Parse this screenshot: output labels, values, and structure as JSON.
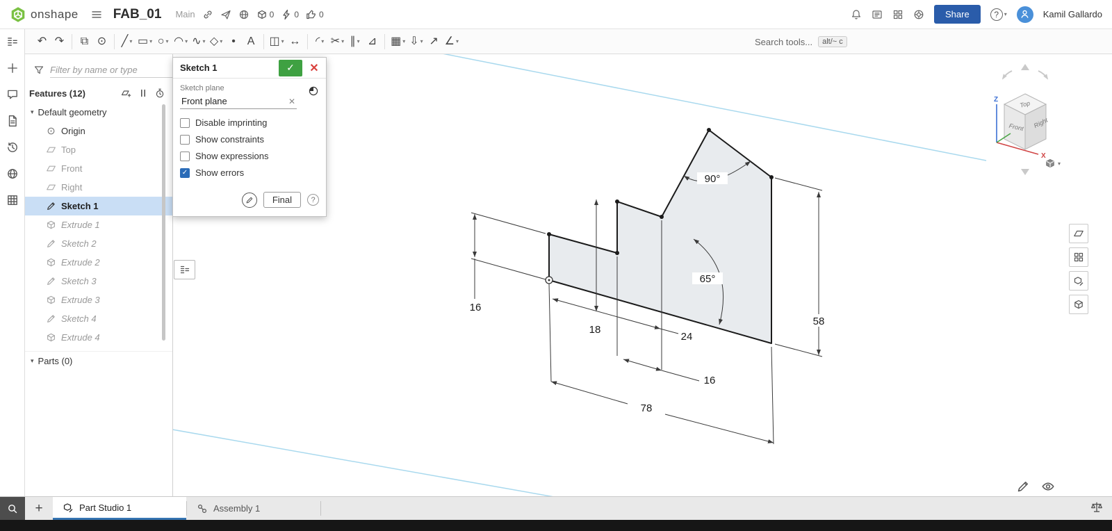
{
  "topbar": {
    "logo_text": "onshape",
    "doc_title": "FAB_01",
    "branch_label": "Main",
    "export_count": "0",
    "history_count": "0",
    "likes_count": "0",
    "share_label": "Share",
    "help_label": "?",
    "user_name": "Kamil Gallardo"
  },
  "toolbar": {
    "search_text": "Search tools...",
    "search_shortcut": "alt/~ c",
    "tools": [
      {
        "id": "undo",
        "glyph": "↶",
        "caret": false
      },
      {
        "id": "redo",
        "glyph": "↷",
        "caret": false
      },
      {
        "id": "copy",
        "glyph": "⧉",
        "caret": false
      },
      {
        "id": "sketch-region",
        "glyph": "⊙",
        "caret": false
      },
      {
        "id": "line",
        "glyph": "╱",
        "caret": true
      },
      {
        "id": "rectangle",
        "glyph": "▭",
        "caret": true
      },
      {
        "id": "circle",
        "glyph": "○",
        "caret": true
      },
      {
        "id": "arc",
        "glyph": "◠",
        "caret": true
      },
      {
        "id": "spline",
        "glyph": "∿",
        "caret": true
      },
      {
        "id": "polygon",
        "glyph": "◇",
        "caret": true
      },
      {
        "id": "point",
        "glyph": "•",
        "caret": false
      },
      {
        "id": "text",
        "glyph": "A",
        "caret": false
      },
      {
        "id": "mirror",
        "glyph": "◫",
        "caret": true
      },
      {
        "id": "dimension",
        "glyph": "↔",
        "caret": false
      },
      {
        "id": "fillet",
        "glyph": "◜",
        "caret": true
      },
      {
        "id": "trim",
        "glyph": "✂",
        "caret": true
      },
      {
        "id": "offset",
        "glyph": "∥",
        "caret": true
      },
      {
        "id": "measure",
        "glyph": "⊿",
        "caret": false
      },
      {
        "id": "pattern",
        "glyph": "▦",
        "caret": true
      },
      {
        "id": "import-dxf",
        "glyph": "⇩",
        "caret": true
      },
      {
        "id": "transform",
        "glyph": "↗",
        "caret": false
      },
      {
        "id": "constraint",
        "glyph": "∠",
        "caret": true
      }
    ]
  },
  "left_rail": {
    "items": [
      {
        "id": "feature-list",
        "icon": "list"
      },
      {
        "id": "insert",
        "icon": "plus"
      },
      {
        "id": "comments",
        "icon": "comment"
      },
      {
        "id": "notes",
        "icon": "doc"
      },
      {
        "id": "history",
        "icon": "history"
      },
      {
        "id": "publications",
        "icon": "globe"
      },
      {
        "id": "tables",
        "icon": "grid"
      }
    ]
  },
  "feature_panel": {
    "filter_placeholder": "Filter by name or type",
    "features_header": "Features (12)",
    "parts_header": "Parts (0)",
    "tree": [
      {
        "label": "Default geometry",
        "type": "group",
        "state": "none"
      },
      {
        "label": "Origin",
        "type": "origin",
        "state": "none"
      },
      {
        "label": "Top",
        "type": "plane",
        "state": "dim"
      },
      {
        "label": "Front",
        "type": "plane",
        "state": "dim"
      },
      {
        "label": "Right",
        "type": "plane",
        "state": "dim"
      },
      {
        "label": "Sketch 1",
        "type": "sketch",
        "state": "selected"
      },
      {
        "label": "Extrude 1",
        "type": "extrude",
        "state": "after"
      },
      {
        "label": "Sketch 2",
        "type": "sketch",
        "state": "after"
      },
      {
        "label": "Extrude 2",
        "type": "extrude",
        "state": "after"
      },
      {
        "label": "Sketch 3",
        "type": "sketch",
        "state": "after"
      },
      {
        "label": "Extrude 3",
        "type": "extrude",
        "state": "after"
      },
      {
        "label": "Sketch 4",
        "type": "sketch",
        "state": "after"
      },
      {
        "label": "Extrude 4",
        "type": "extrude",
        "state": "after"
      }
    ]
  },
  "dialog": {
    "title": "Sketch 1",
    "plane_label": "Sketch plane",
    "plane_value": "Front plane",
    "checkboxes": [
      {
        "label": "Disable imprinting",
        "checked": false
      },
      {
        "label": "Show constraints",
        "checked": false
      },
      {
        "label": "Show expressions",
        "checked": false
      },
      {
        "label": "Show errors",
        "checked": true
      }
    ],
    "final_label": "Final"
  },
  "canvas": {
    "dims": {
      "angle_top": "90°",
      "angle_mid": "65°",
      "left_height": "16",
      "step_height": "18",
      "mid_width": "24",
      "notch_width": "16",
      "right_height": "58",
      "base_width": "78"
    }
  },
  "viewcube": {
    "top": "Top",
    "front": "Front",
    "right": "Right",
    "axis_z": "Z",
    "axis_x": "X"
  },
  "right_dock": {
    "items": [
      {
        "id": "display-panel",
        "icon": "plane"
      },
      {
        "id": "appearance-panel",
        "icon": "apps"
      },
      {
        "id": "configuration-panel",
        "icon": "parttab"
      },
      {
        "id": "custom-table-panel",
        "icon": "box"
      }
    ]
  },
  "canvas_icons": [
    {
      "id": "sketch-settings",
      "icon": "pencil"
    },
    {
      "id": "view-settings",
      "icon": "eye"
    }
  ],
  "tabs": {
    "items": [
      {
        "label": "Part Studio 1",
        "active": true
      },
      {
        "label": "Assembly 1",
        "active": false
      }
    ]
  },
  "colors": {
    "accent_blue": "#2a5caa",
    "logo_green": "#7ac143",
    "commit_green": "#3fa142",
    "cancel_red": "#d9413d",
    "selection_blue": "#c9def5",
    "plane_blue": "#a9d9ee"
  }
}
